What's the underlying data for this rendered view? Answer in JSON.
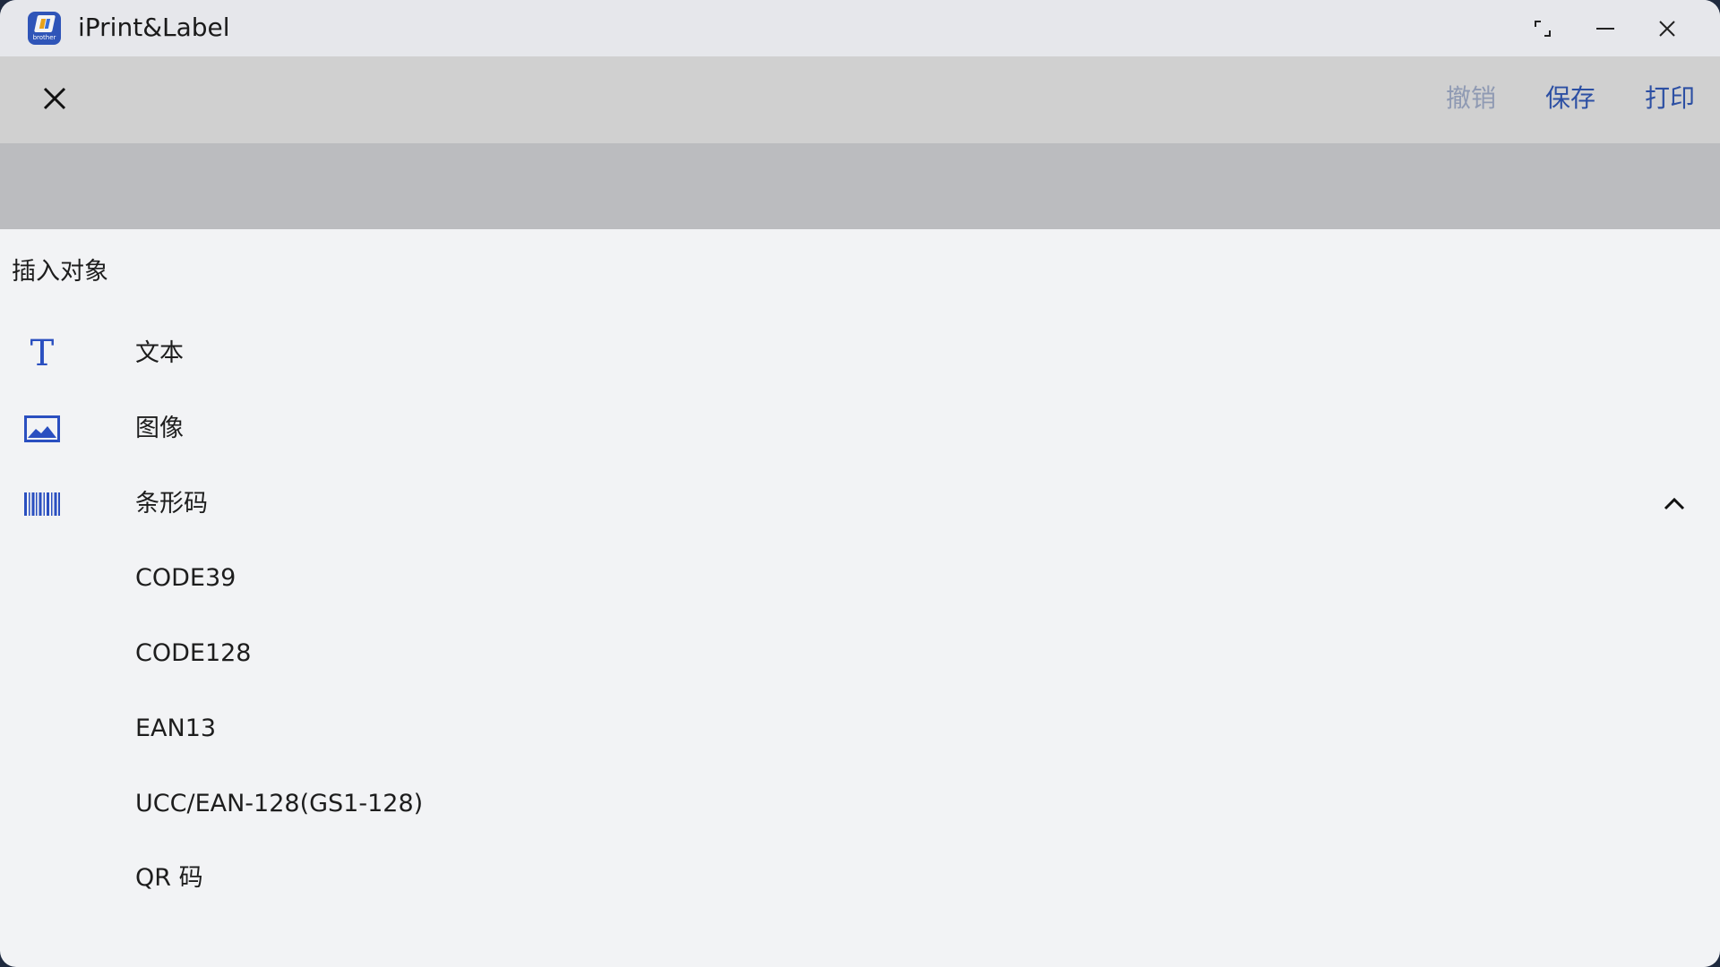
{
  "window": {
    "title": "iPrint&Label",
    "app_icon_brand": "brother",
    "controls": {
      "restore": "restore-icon",
      "minimize": "minimize-icon",
      "close": "close-icon"
    }
  },
  "toolbar": {
    "close_icon": "close-icon",
    "undo_label": "撤销",
    "save_label": "保存",
    "print_label": "打印"
  },
  "insert_panel": {
    "title": "插入对象",
    "items": [
      {
        "label": "文本",
        "icon": "text-icon"
      },
      {
        "label": "图像",
        "icon": "image-icon"
      },
      {
        "label": "条形码",
        "icon": "barcode-icon",
        "expanded": true
      }
    ],
    "barcode_types": [
      {
        "label": "CODE39"
      },
      {
        "label": "CODE128"
      },
      {
        "label": "EAN13"
      },
      {
        "label": "UCC/EAN-128(GS1-128)"
      },
      {
        "label": "QR 码"
      }
    ]
  },
  "colors": {
    "accent": "#2c4fa3",
    "disabled": "#8f9ab3",
    "icon_blue": "#2a4fc0"
  }
}
